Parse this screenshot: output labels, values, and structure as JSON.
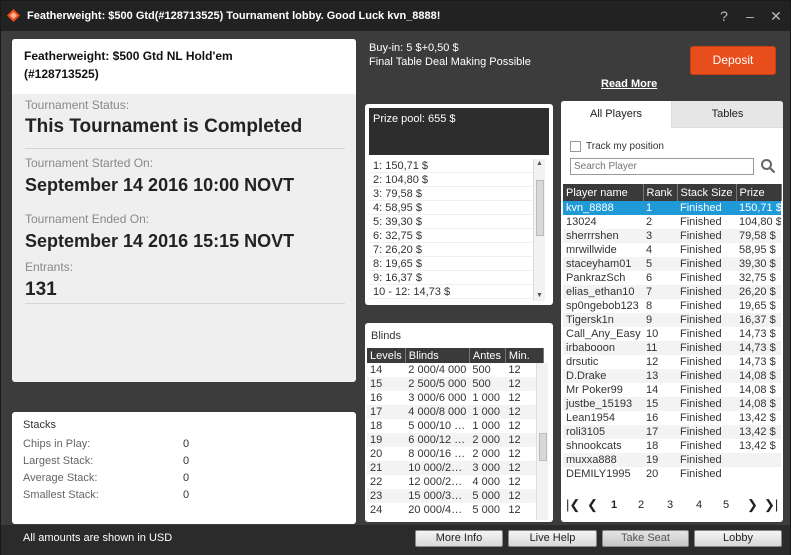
{
  "window": {
    "title": "Featherweight: $500 Gtd(#128713525) Tournament lobby. Good Luck kvn_8888!",
    "help": "?",
    "minimize": "–",
    "close": "✕"
  },
  "info": {
    "name_line1": "Featherweight: $500 Gtd NL Hold'em",
    "name_line2": "(#128713525)",
    "status_label": "Tournament Status:",
    "status_value": "This Tournament is Completed",
    "started_label": "Tournament Started On:",
    "started_value": "September 14 2016  10:00 NOVT",
    "ended_label": "Tournament Ended On:",
    "ended_value": "September 14 2016  15:15 NOVT",
    "entrants_label": "Entrants:",
    "entrants_value": "131"
  },
  "stacks": {
    "title": "Stacks",
    "rows": [
      {
        "label": "Chips in Play:",
        "value": "0"
      },
      {
        "label": "Largest Stack:",
        "value": "0"
      },
      {
        "label": "Average Stack:",
        "value": "0"
      },
      {
        "label": "Smallest Stack:",
        "value": "0"
      }
    ]
  },
  "header": {
    "buyin": "Buy-in: 5 $+0,50 $",
    "deal": "Final Table Deal Making Possible",
    "read_more": "Read More",
    "deposit": "Deposit"
  },
  "prize": {
    "pool": "Prize pool: 655 $",
    "places": [
      "1: 150,71 $",
      "2: 104,80 $",
      "3: 79,58 $",
      "4: 58,95 $",
      "5: 39,30 $",
      "6: 32,75 $",
      "7: 26,20 $",
      "8: 19,65 $",
      "9: 16,37 $",
      "10 - 12: 14,73 $"
    ]
  },
  "blinds": {
    "title": "Blinds",
    "headers": [
      "Levels",
      "Blinds",
      "Antes",
      "Min."
    ],
    "rows": [
      [
        "14",
        "2 000/4 000",
        "500",
        "12"
      ],
      [
        "15",
        "2 500/5 000",
        "500",
        "12"
      ],
      [
        "16",
        "3 000/6 000",
        "1 000",
        "12"
      ],
      [
        "17",
        "4 000/8 000",
        "1 000",
        "12"
      ],
      [
        "18",
        "5 000/10 …",
        "1 000",
        "12"
      ],
      [
        "19",
        "6 000/12 …",
        "2 000",
        "12"
      ],
      [
        "20",
        "8 000/16 …",
        "2 000",
        "12"
      ],
      [
        "21",
        "10 000/2…",
        "3 000",
        "12"
      ],
      [
        "22",
        "12 000/2…",
        "4 000",
        "12"
      ],
      [
        "23",
        "15 000/3…",
        "5 000",
        "12"
      ],
      [
        "24",
        "20 000/4…",
        "5 000",
        "12"
      ]
    ]
  },
  "players": {
    "tab_all": "All Players",
    "tab_tables": "Tables",
    "track_label": "Track my position",
    "search_placeholder": "Search Player",
    "headers": [
      "Player name",
      "Rank",
      "Stack Size",
      "Prize"
    ],
    "rows": [
      [
        "kvn_8888",
        "1",
        "Finished",
        "150,71 $"
      ],
      [
        "13024",
        "2",
        "Finished",
        "104,80 $"
      ],
      [
        "sherrrshen",
        "3",
        "Finished",
        "79,58 $"
      ],
      [
        "mrwillwide",
        "4",
        "Finished",
        "58,95 $"
      ],
      [
        "staceyham01",
        "5",
        "Finished",
        "39,30 $"
      ],
      [
        "PankrazSch",
        "6",
        "Finished",
        "32,75 $"
      ],
      [
        "elias_ethan10",
        "7",
        "Finished",
        "26,20 $"
      ],
      [
        "sp0ngebob123",
        "8",
        "Finished",
        "19,65 $"
      ],
      [
        "Tigersk1n",
        "9",
        "Finished",
        "16,37 $"
      ],
      [
        "Call_Any_Easy",
        "10",
        "Finished",
        "14,73 $"
      ],
      [
        "irbabooon",
        "11",
        "Finished",
        "14,73 $"
      ],
      [
        "drsutic",
        "12",
        "Finished",
        "14,73 $"
      ],
      [
        "D.Drake",
        "13",
        "Finished",
        "14,08 $"
      ],
      [
        "Mr Poker99",
        "14",
        "Finished",
        "14,08 $"
      ],
      [
        "justbe_15193",
        "15",
        "Finished",
        "14,08 $"
      ],
      [
        "Lean1954",
        "16",
        "Finished",
        "13,42 $"
      ],
      [
        "roli3105",
        "17",
        "Finished",
        "13,42 $"
      ],
      [
        "shnookcats",
        "18",
        "Finished",
        "13,42 $"
      ],
      [
        "muxxa888",
        "19",
        "Finished",
        ""
      ],
      [
        "DEMILY1995",
        "20",
        "Finished",
        ""
      ]
    ],
    "pages": [
      "1",
      "2",
      "3",
      "4",
      "5"
    ]
  },
  "footer": {
    "note": "All amounts are shown in USD",
    "more_info": "More Info",
    "live_help": "Live Help",
    "take_seat": "Take Seat",
    "lobby": "Lobby"
  },
  "colors": {
    "accent": "#e84e1b",
    "selected_row": "#1f9ad6",
    "dark_bg": "#3c3c3c"
  }
}
